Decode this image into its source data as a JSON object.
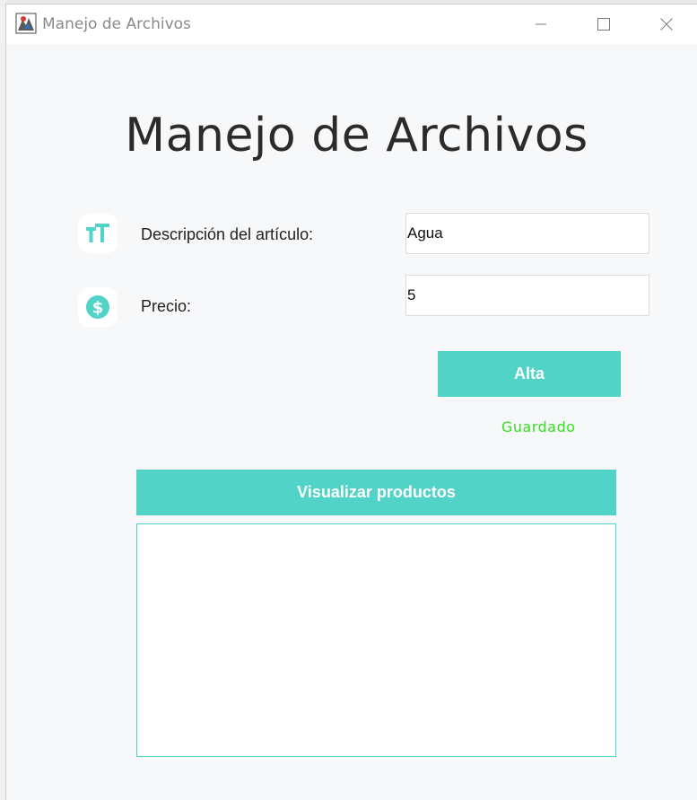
{
  "window": {
    "title": "Manejo de Archivos",
    "controls": {
      "minimize_icon": "minimize-icon",
      "maximize_icon": "maximize-icon",
      "close_icon": "close-icon"
    }
  },
  "main": {
    "heading": "Manejo de Archivos",
    "fields": [
      {
        "icon": "text-size-icon",
        "label": "Descripción del artículo:",
        "value": "Agua"
      },
      {
        "icon": "dollar-coin-icon",
        "label": "Precio:",
        "value": "5"
      }
    ],
    "add_button_label": "Alta",
    "status_text": "Guardado",
    "view_button_label": "Visualizar productos",
    "products_output": ""
  },
  "colors": {
    "accent": "#52d3c7",
    "status_success": "#35e01e",
    "background": "#f7f8fa"
  }
}
